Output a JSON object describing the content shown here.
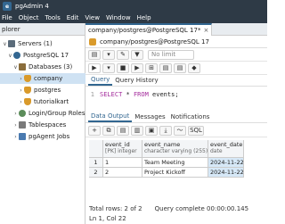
{
  "window": {
    "title": "pgAdmin 4"
  },
  "menubar": [
    "File",
    "Object",
    "Tools",
    "Edit",
    "View",
    "Window",
    "Help"
  ],
  "explorer": {
    "header": "plorer",
    "tree": [
      {
        "label": "Servers (1)",
        "icon": "server-icon",
        "indent": 0,
        "chev": "∨"
      },
      {
        "label": "PostgreSQL 17",
        "icon": "postgres-icon",
        "indent": 1,
        "chev": "∨"
      },
      {
        "label": "Databases (3)",
        "icon": "databases-icon",
        "indent": 2,
        "chev": "∨"
      },
      {
        "label": "company",
        "icon": "database-icon",
        "indent": 3,
        "chev": "›",
        "selected": true
      },
      {
        "label": "postgres",
        "icon": "database-icon",
        "indent": 3,
        "chev": "›"
      },
      {
        "label": "tutorialkart",
        "icon": "database-icon",
        "indent": 3,
        "chev": "›"
      },
      {
        "label": "Login/Group Roles",
        "icon": "roles-icon",
        "indent": 2,
        "chev": "›"
      },
      {
        "label": "Tablespaces",
        "icon": "tablespaces-icon",
        "indent": 2,
        "chev": "›"
      },
      {
        "label": "pgAgent Jobs",
        "icon": "pgagent-icon",
        "indent": 2,
        "chev": "›"
      }
    ]
  },
  "query_tab": {
    "label": "company/postgres@PostgreSQL 17*",
    "close": "×"
  },
  "connection": {
    "label": "company/postgres@PostgreSQL 17"
  },
  "limit": {
    "placeholder": "No limit"
  },
  "editor_tabs": [
    "Query",
    "Query History"
  ],
  "editor": {
    "line_number": "1",
    "keyword1": "SELECT",
    "star": "*",
    "keyword2": "FROM",
    "table": "events;"
  },
  "output_tabs": [
    "Data Output",
    "Messages",
    "Notifications"
  ],
  "sql_label": "SQL",
  "results": {
    "columns": [
      {
        "name": "event_id",
        "type": "[PK] integer"
      },
      {
        "name": "event_name",
        "type": "character varying (255)"
      },
      {
        "name": "event_date",
        "type": "date"
      }
    ],
    "rows": [
      {
        "num": "1",
        "event_id": "1",
        "event_name": "Team Meeting",
        "event_date": "2024-11-22"
      },
      {
        "num": "2",
        "event_id": "2",
        "event_name": "Project Kickoff",
        "event_date": "2024-11-22"
      }
    ]
  },
  "status": {
    "total_rows": "Total rows: 2 of 2",
    "query_complete": "Query complete 00:00:00.145",
    "cursor": "Ln 1, Col 22"
  },
  "colors": {
    "titlebar": "#2e3a46",
    "accent": "#326690",
    "selected_row": "#cfe2f3",
    "date_cell": "#d6e8f7"
  }
}
